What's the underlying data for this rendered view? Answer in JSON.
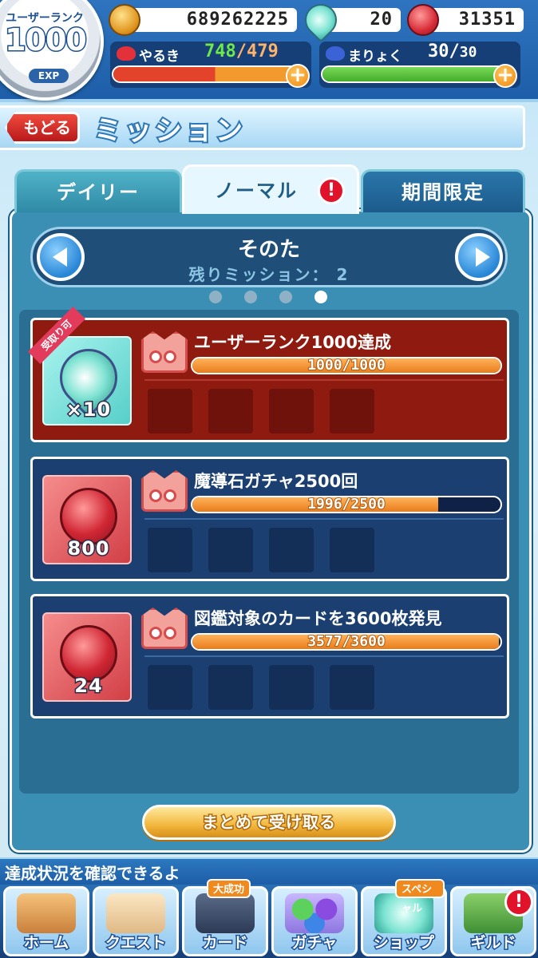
{
  "user_rank": {
    "label": "ユーザーランク",
    "value": "1000",
    "exp_label": "EXP"
  },
  "currencies": {
    "coins": {
      "icon": "coin-icon",
      "value": "689262225"
    },
    "gems": {
      "icon": "gem-icon",
      "value": "20"
    },
    "stones": {
      "icon": "magic-stone-icon",
      "value": "31351"
    }
  },
  "stamina": {
    "yaruki": {
      "label": "やるき",
      "current": "748",
      "separator": "/",
      "max": "479",
      "fill_percent": 100
    },
    "maryoku": {
      "label": "まりょく",
      "current": "30",
      "separator": "/",
      "max": "30",
      "fill_percent": 100
    }
  },
  "header": {
    "back_label": "もどる",
    "title": "ミッション"
  },
  "tabs": [
    {
      "label": "デイリー",
      "active": false
    },
    {
      "label": "ノーマル",
      "active": true,
      "alert": "!"
    },
    {
      "label": "期間限定",
      "active": false
    }
  ],
  "category": {
    "name": "そのた",
    "remaining": "残りミッション： 2",
    "page_count": 4,
    "active_page": 4
  },
  "missions": [
    {
      "title": "ユーザーランク1000達成",
      "progress_text": "1000/1000",
      "progress": 1.0,
      "reward_icon": "gem-icon",
      "reward_count": "×10",
      "ribbon": "受取り可",
      "status": "done"
    },
    {
      "title": "魔導石ガチャ2500回",
      "progress_text": "1996/2500",
      "progress": 0.7984,
      "reward_icon": "magic-stone-icon",
      "reward_count": "800",
      "status": "todo"
    },
    {
      "title": "図鑑対象のカードを3600枚発見",
      "progress_text": "3577/3600",
      "progress": 0.9936,
      "reward_icon": "magic-stone-icon",
      "reward_count": "24",
      "status": "todo"
    }
  ],
  "claim_all_label": "まとめて受け取る",
  "hint": "達成状況を確認できるよ",
  "nav": [
    {
      "label": "ホーム",
      "icon": "home-icon"
    },
    {
      "label": "クエスト",
      "icon": "quest-map-icon"
    },
    {
      "label": "カード",
      "icon": "card-icon",
      "badge": "大成功"
    },
    {
      "label": "ガチャ",
      "icon": "gacha-icon"
    },
    {
      "label": "ショップ",
      "icon": "shop-icon",
      "badge": "スペシャル"
    },
    {
      "label": "ギルド",
      "icon": "guild-icon",
      "alert": "!"
    }
  ],
  "colors": {
    "accent_orange": "#e87c1c",
    "done_red": "#8f1a10",
    "todo_navy": "#1b3f71",
    "panel_blue": "#3c8fb4"
  }
}
